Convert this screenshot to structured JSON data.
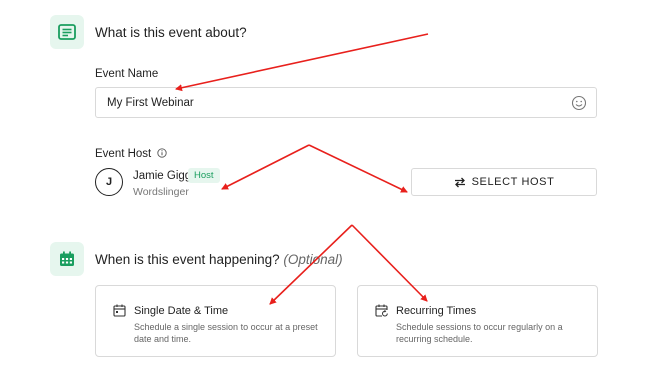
{
  "section1": {
    "title": "What is this event about?",
    "icon": "list-icon"
  },
  "event_name": {
    "label": "Event Name",
    "value": "My First Webinar",
    "emoji_icon": "smiley-icon"
  },
  "event_host": {
    "label": "Event Host",
    "avatar_initial": "J",
    "name": "Jamie Giggs",
    "badge": "Host",
    "subtitle": "Wordslinger",
    "select_button": "SELECT HOST"
  },
  "section2": {
    "title": "When is this event happening?",
    "optional": "(Optional)",
    "icon": "calendar-icon"
  },
  "cards": [
    {
      "title": "Single Date & Time",
      "description": "Schedule a single session to occur at a preset date and time."
    },
    {
      "title": "Recurring Times",
      "description": "Schedule sessions to occur regularly on a recurring schedule."
    }
  ],
  "colors": {
    "accent_green": "#1a9e5f",
    "icon_bg": "#e6f6ee",
    "arrow_red": "#e8201c"
  }
}
